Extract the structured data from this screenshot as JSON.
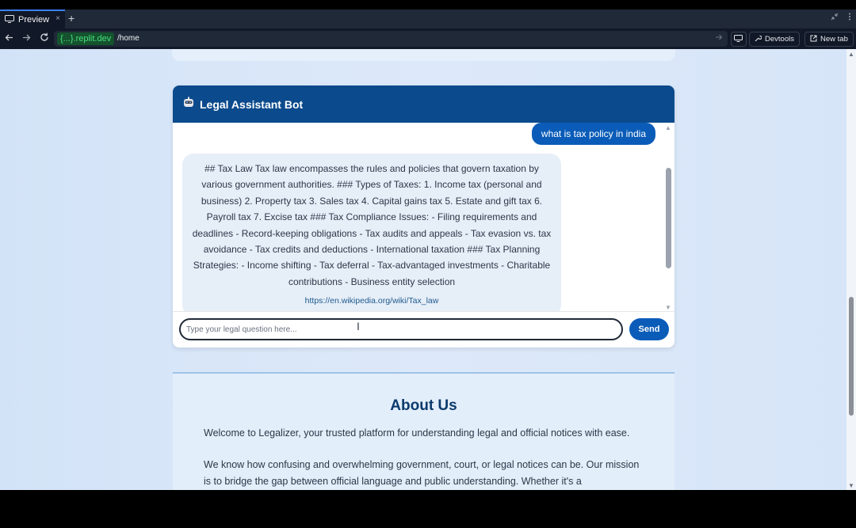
{
  "browser": {
    "tab_title": "Preview",
    "tab_close": "×",
    "new_tab_plus": "+",
    "domain": "{...}.replit.dev",
    "path": "/home",
    "devtools_label": "Devtools",
    "newtab_label": "New tab"
  },
  "chat": {
    "title": "Legal Assistant Bot",
    "user_message": "what is tax policy in india",
    "bot_message": "## Tax Law Tax law encompasses the rules and policies that govern taxation by various government authorities. ### Types of Taxes: 1. Income tax (personal and business) 2. Property tax 3. Sales tax 4. Capital gains tax 5. Estate and gift tax 6. Payroll tax 7. Excise tax ### Tax Compliance Issues: - Filing requirements and deadlines - Record-keeping obligations - Tax audits and appeals - Tax evasion vs. tax avoidance - Tax credits and deductions - International taxation ### Tax Planning Strategies: - Income shifting - Tax deferral - Tax-advantaged investments - Charitable contributions - Business entity selection",
    "bot_link": "https://en.wikipedia.org/wiki/Tax_law",
    "input_placeholder": "Type your legal question here...",
    "send_label": "Send"
  },
  "about": {
    "title": "About Us",
    "p1": "Welcome to Legalizer, your trusted platform for understanding legal and official notices with ease.",
    "p2": "We know how confusing and overwhelming government, court, or legal notices can be. Our mission is to bridge the gap between official language and public understanding. Whether it's a"
  },
  "colors": {
    "header_bg": "#0b4a8c",
    "accent": "#0b5cb8"
  }
}
